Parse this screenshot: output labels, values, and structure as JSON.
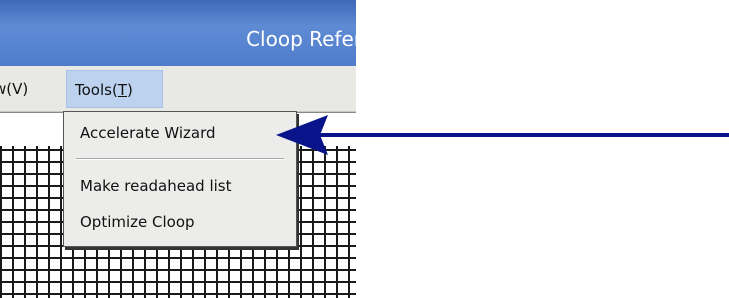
{
  "window": {
    "title": "Cloop Refer"
  },
  "menu_bar": {
    "view_label": "w(V)",
    "tools_prefix": "Tools(",
    "tools_mnemonic": "T",
    "tools_suffix": ")"
  },
  "tools_menu": {
    "items": [
      "Accelerate Wizard",
      "Make readahead list",
      "Optimize Cloop"
    ]
  },
  "annotation": {
    "arrow_color": "#0a148a"
  }
}
